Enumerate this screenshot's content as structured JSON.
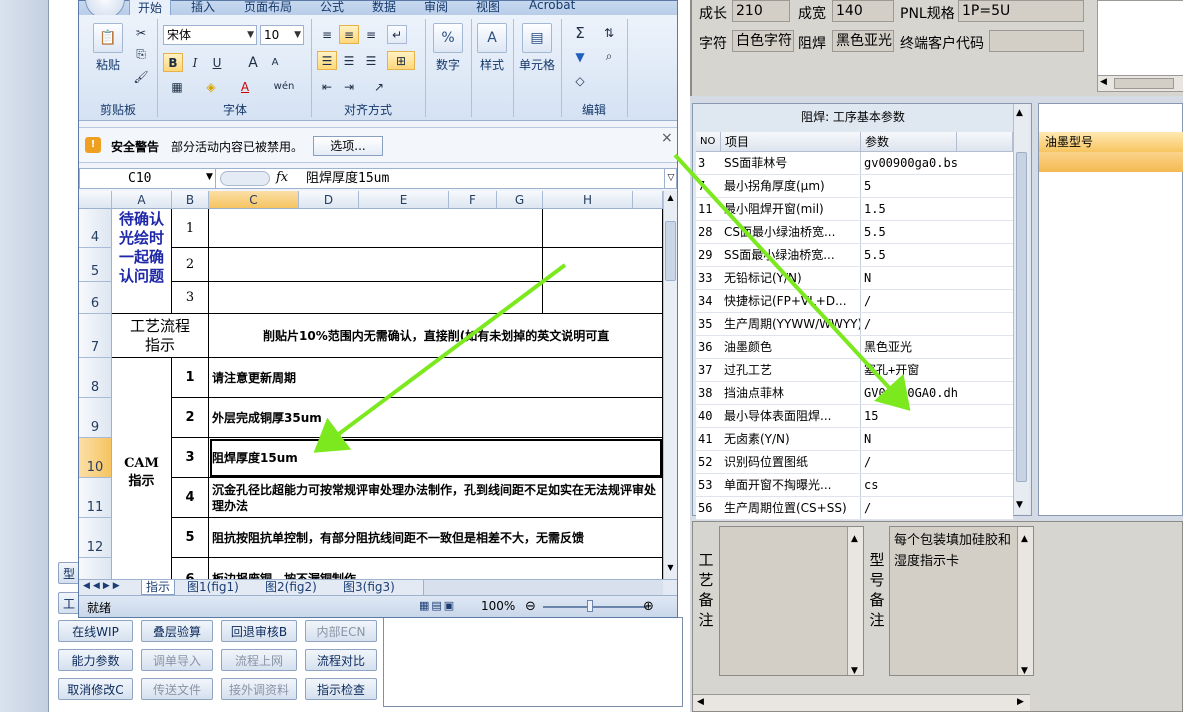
{
  "background_app": {
    "buttons": [
      {
        "label": "在线WIP",
        "disabled": false
      },
      {
        "label": "叠层验算",
        "disabled": false
      },
      {
        "label": "回退审核B",
        "disabled": false
      },
      {
        "label": "内部ECN",
        "disabled": true
      },
      {
        "label": "能力参数",
        "disabled": false
      },
      {
        "label": "调单导入",
        "disabled": true
      },
      {
        "label": "流程上网",
        "disabled": true
      },
      {
        "label": "流程对比",
        "disabled": false
      },
      {
        "label": "取消修改C",
        "disabled": false
      },
      {
        "label": "传送文件",
        "disabled": true
      },
      {
        "label": "接外调资料",
        "disabled": true
      },
      {
        "label": "指示检查",
        "disabled": false
      }
    ],
    "partial_buttons": [
      "型",
      "工"
    ]
  },
  "excel": {
    "tabs": [
      "开始",
      "插入",
      "页面布局",
      "公式",
      "数据",
      "审阅",
      "视图",
      "Acrobat"
    ],
    "active_tab": "开始",
    "ribbon": {
      "paste_label": "粘贴",
      "clipboard_label": "剪贴板",
      "font_name": "宋体",
      "font_size": "10",
      "font_group_label": "字体",
      "alignment_group_label": "对齐方式",
      "number_label": "数字",
      "style_label": "样式",
      "cells_label": "单元格",
      "edit_label": "编辑",
      "bold": "B",
      "italic": "I",
      "underline": "U",
      "grow": "A",
      "shrink": "A",
      "font_color": "A",
      "wen": "wén",
      "sigma": "Σ"
    },
    "security": {
      "title": "安全警告",
      "message": "部分活动内容已被禁用。",
      "options": "选项...",
      "close": "×"
    },
    "formula": {
      "name_box": "C10",
      "fx": "fx",
      "content": "阻焊厚度15um"
    },
    "columns": [
      "A",
      "B",
      "C",
      "D",
      "E",
      "F",
      "G",
      "H"
    ],
    "selected_column": "C",
    "rows": [
      "4",
      "5",
      "6",
      "7",
      "8",
      "9",
      "10",
      "11",
      "12"
    ],
    "selected_row": "10",
    "cells": {
      "confirm_label": "待确认光绘时一起确认问题",
      "confirm_nums": [
        "1",
        "2",
        "3"
      ],
      "process_label": "工艺流程指示",
      "process_text": "削贴片10%范围内无需确认，直接削(如有未划掉的英文说明可直",
      "cam_label": "CAM指示",
      "cam_items": [
        {
          "num": "1",
          "text": "请注意更新周期"
        },
        {
          "num": "2",
          "text": "外层完成铜厚35um"
        },
        {
          "num": "3",
          "text": "阻焊厚度15um"
        },
        {
          "num": "4",
          "text": "沉金孔径比超能力可按常规评审处理办法制作，孔到线间距不足如实在无法规评审处理办法"
        },
        {
          "num": "5",
          "text": "阻抗按阻抗单控制，有部分阻抗线间距不一致但是相差不大，无需反馈"
        },
        {
          "num": "6",
          "text": "板边报废铜，按不漏铜制作"
        }
      ]
    },
    "sheet_tabs": [
      "指示",
      "图1(fig1)",
      "图2(fig2)",
      "图3(fig3)"
    ],
    "active_sheet": "指示",
    "status": {
      "ready": "就绪",
      "zoom": "100%"
    }
  },
  "right_top": {
    "fields": [
      {
        "label": "成长",
        "value": "210"
      },
      {
        "label": "成宽",
        "value": "140"
      },
      {
        "label": "PNL规格",
        "value": "1P=5U"
      },
      {
        "label": "字符",
        "value": "白色字符"
      },
      {
        "label": "阻焊",
        "value": "黑色亚光"
      },
      {
        "label": "终端客户代码",
        "value": ""
      }
    ]
  },
  "params": {
    "title": "阻焊: 工序基本参数",
    "headers": [
      "NO",
      "项目",
      "参数"
    ],
    "rows": [
      {
        "no": "3",
        "item": "SS面菲林号",
        "value": "gv00900ga0.bs"
      },
      {
        "no": "7",
        "item": "最小拐角厚度(μm)",
        "value": "5"
      },
      {
        "no": "11",
        "item": "最小阻焊开窗(mil)",
        "value": "1.5"
      },
      {
        "no": "28",
        "item": "CS面最小绿油桥宽...",
        "value": "5.5"
      },
      {
        "no": "29",
        "item": "SS面最小绿油桥宽...",
        "value": "5.5"
      },
      {
        "no": "33",
        "item": "无铅标记(Y/N)",
        "value": "N"
      },
      {
        "no": "34",
        "item": "快捷标记(FP+VL+D...",
        "value": "/"
      },
      {
        "no": "35",
        "item": "生产周期(YYWW/WWYY)",
        "value": "/"
      },
      {
        "no": "36",
        "item": "油墨颜色",
        "value": "黑色亚光"
      },
      {
        "no": "37",
        "item": "过孔工艺",
        "value": "塞孔+开窗"
      },
      {
        "no": "38",
        "item": "挡油点菲林",
        "value": "GV00900GA0.dh"
      },
      {
        "no": "40",
        "item": "最小导体表面阻焊...",
        "value": "15"
      },
      {
        "no": "41",
        "item": "无卤素(Y/N)",
        "value": "N"
      },
      {
        "no": "52",
        "item": "识别码位置图纸",
        "value": "/"
      },
      {
        "no": "53",
        "item": "单面开窗不掏曝光...",
        "value": "cs"
      },
      {
        "no": "56",
        "item": "生产周期位置(CS+SS)",
        "value": "/"
      }
    ]
  },
  "ink": {
    "header": "油墨型号"
  },
  "notes": {
    "process_note_label": "工艺备注",
    "model_note_label": "型号备注",
    "model_note_text": "每个包装填加硅胶和湿度指示卡"
  }
}
